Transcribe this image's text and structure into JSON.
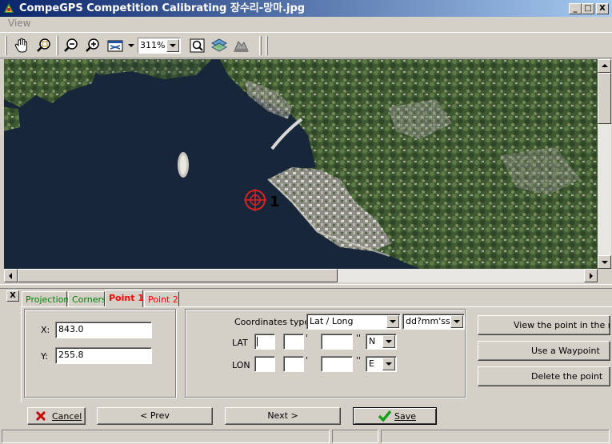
{
  "window": {
    "title": "CompeGPS Competition Calibrating 장수리-망마.jpg",
    "minimize_glyph": "_",
    "maximize_glyph": "□",
    "close_glyph": "X"
  },
  "menu": {
    "view_label": "View"
  },
  "toolbar": {
    "zoom_value": "311%",
    "tools": [
      "hand-icon",
      "zoom-window-icon",
      "zoom-out-icon",
      "zoom-in-icon",
      "fit-image-icon",
      "find-icon",
      "map-layers-icon",
      "3d-view-icon"
    ]
  },
  "map": {
    "marker_label": "1"
  },
  "panel": {
    "close_glyph": "X",
    "tabs": [
      {
        "label": "Projection",
        "color": "#008000"
      },
      {
        "label": "Corners",
        "color": "#008000"
      },
      {
        "label": "Point 1",
        "color": "#ff0000"
      },
      {
        "label": "Point 2",
        "color": "#ff0000"
      }
    ],
    "active_tab": "Point 1",
    "image_coords": {
      "x_label": "X:",
      "x_value": "843.0",
      "y_label": "Y:",
      "y_value": "255.8"
    },
    "coordinates": {
      "type_label": "Coordinates type:",
      "type_value": "Lat / Long",
      "format_value": "dd?mm'ss.s'",
      "lat_label": "LAT",
      "lon_label": "LON",
      "minute_mark": "'",
      "second_mark": "''",
      "lat_deg": "",
      "lat_min": "",
      "lat_sec": "",
      "lat_hemi": "N",
      "lon_deg": "",
      "lon_min": "",
      "lon_sec": "",
      "lon_hemi": "E"
    },
    "actions": {
      "view_point_label": "View the point in the map",
      "use_waypoint_label": "Use a Waypoint",
      "delete_point_label": "Delete the point"
    }
  },
  "footer": {
    "cancel_label": "Cancel",
    "prev_label": "< Prev",
    "next_label": "Next >",
    "save_label": "Save"
  },
  "colors": {
    "titlebar_start": "#0a246a",
    "titlebar_end": "#a6caf0",
    "marker": "#e02020",
    "cancel_icon": "#cc0000",
    "save_icon": "#1a9e1a"
  }
}
